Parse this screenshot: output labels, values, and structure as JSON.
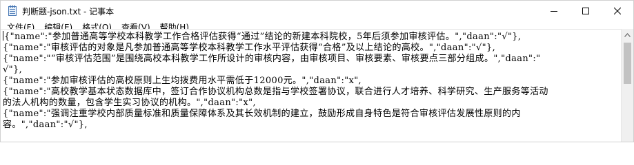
{
  "window": {
    "title": "判断题-json.txt - 记事本"
  },
  "menu": {
    "items": [
      "文件(F)",
      "编辑(E)",
      "格式(O)",
      "查看(V)",
      "帮助(H)"
    ]
  },
  "editor": {
    "lines": [
      "{\"name\":\"参加普通高等学校本科教学工作合格评估获得“通过”结论的新建本科院校，5年后须参加审核评估。\",\"daan\":\"√\"},",
      "{\"name\":\"审核评估的对象是凡参加普通高等学校本科教学工作水平评估获得“合格”及以上结论的高校。\",\"daan\":\"√\"},",
      "{\"name\":\"“审核评估范围”是围绕高校本科教学工作所设计的审核内容，由审核项目、审核要素、审核要点三部分组成。\",\"daan\":\"",
      "√\"},",
      "{\"name\":\"参加审核评估的高校原则上生均拨费用水平需低于12000元。\",\"daan\":\"x\",",
      "{\"name\":\"高校教学基本状态数据库中，签订合作协议机构总数是指与学校签署协议，联合进行人才培养、科学研究、生产服务等活动",
      "的法人机构的数量，包含学生实习协议的机构。\",\"daan\":\"x\",",
      "{\"name\":\"强调注重学校内部质量标准和质量保障体系及其长效机制的建立，鼓励形成自身特色是符合审核评估发展性原则的内",
      "容。\",\"daan\":\"√\"},"
    ]
  }
}
